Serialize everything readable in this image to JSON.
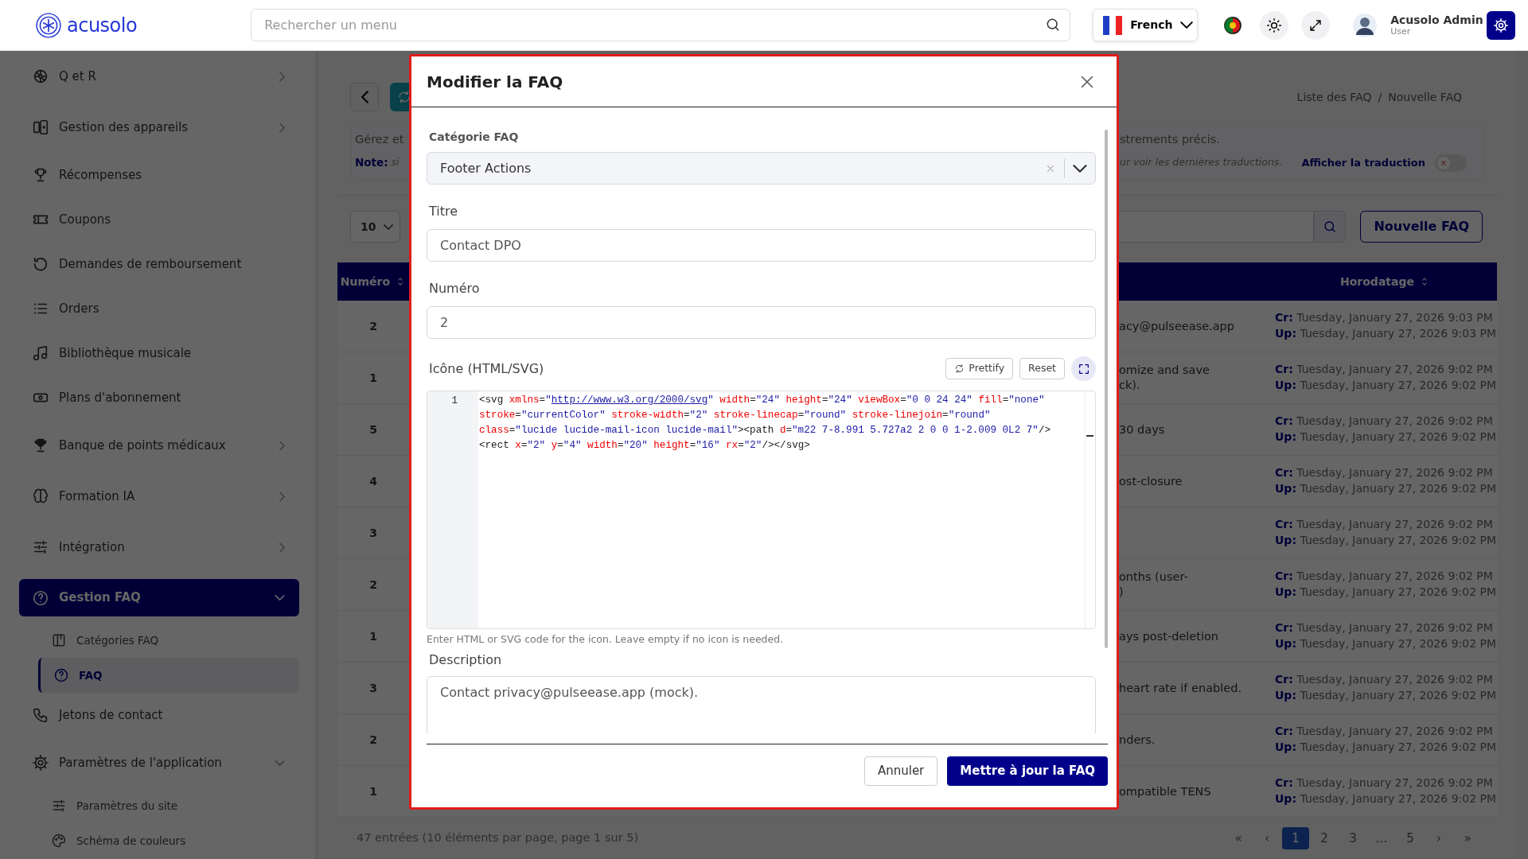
{
  "topbar": {
    "logo": "acusolo",
    "search": {
      "placeholder": "Rechercher un menu"
    },
    "language": "French",
    "user": {
      "name": "Acusolo Admin",
      "role": "User"
    }
  },
  "sidebar": {
    "items": [
      {
        "kind": "group",
        "label": "Q et R",
        "expanded": false,
        "selected": false
      },
      {
        "kind": "group",
        "label": "Gestion des appareils",
        "expanded": false,
        "selected": false
      },
      {
        "kind": "link",
        "label": "Récompenses",
        "selected": false
      },
      {
        "kind": "link",
        "label": "Coupons",
        "selected": false
      },
      {
        "kind": "link",
        "label": "Demandes de remboursement",
        "selected": false
      },
      {
        "kind": "link",
        "label": "Orders",
        "selected": false
      },
      {
        "kind": "link",
        "label": "Bibliothèque musicale",
        "selected": false
      },
      {
        "kind": "link",
        "label": "Plans d'abonnement",
        "selected": false
      },
      {
        "kind": "group",
        "label": "Banque de points médicaux",
        "expanded": false,
        "selected": false
      },
      {
        "kind": "group",
        "label": "Formation IA",
        "expanded": false,
        "selected": false
      },
      {
        "kind": "group",
        "label": "Intégration",
        "expanded": false,
        "selected": false
      },
      {
        "kind": "group",
        "label": "Gestion FAQ",
        "expanded": true,
        "selected": true,
        "children": [
          {
            "label": "Catégories FAQ",
            "selected": false
          },
          {
            "label": "FAQ",
            "selected": true
          }
        ]
      },
      {
        "kind": "link",
        "label": "Jetons de contact",
        "selected": false
      },
      {
        "kind": "group",
        "label": "Paramètres de l'application",
        "expanded": true,
        "selected": false,
        "children": [
          {
            "label": "Paramètres du site",
            "selected": false
          },
          {
            "label": "Schéma de couleurs",
            "selected": false
          }
        ]
      }
    ]
  },
  "page": {
    "breadcrumb": [
      "Liste des FAQ",
      "Nouvelle FAQ"
    ],
    "breadcrumb_separator": "/",
    "info": {
      "line_start": "Gérez et",
      "line_end": "strements précis.",
      "note_label": "Note:",
      "note_start": "si",
      "note_end": "ur voir les dernières traductions.",
      "toggle": {
        "label": "Afficher la traduction",
        "on": false
      }
    },
    "page_size": "10",
    "new_button": "Nouvelle FAQ",
    "table": {
      "columns": [
        "Numéro",
        "Horodatage"
      ],
      "rows": [
        {
          "number": "2",
          "description": [
            "acy@pulseease.app"
          ],
          "created_label": "Cr:",
          "created": "Tuesday, January 27, 2026 9:03 PM",
          "updated_label": "Up:",
          "updated": "Tuesday, January 27, 2026 9:03 PM"
        },
        {
          "number": "1",
          "description": [
            "omize and save",
            "ck)."
          ],
          "created_label": "Cr:",
          "created": "Tuesday, January 27, 2026 9:02 PM",
          "updated_label": "Up:",
          "updated": "Tuesday, January 27, 2026 9:02 PM"
        },
        {
          "number": "5",
          "description": [
            "30 days"
          ],
          "created_label": "Cr:",
          "created": "Tuesday, January 27, 2026 9:02 PM",
          "updated_label": "Up:",
          "updated": "Tuesday, January 27, 2026 9:02 PM"
        },
        {
          "number": "4",
          "description": [
            "ost-closure"
          ],
          "created_label": "Cr:",
          "created": "Tuesday, January 27, 2026 9:02 PM",
          "updated_label": "Up:",
          "updated": "Tuesday, January 27, 2026 9:02 PM"
        },
        {
          "number": "3",
          "created_label": "Cr:",
          "created": "Tuesday, January 27, 2026 9:02 PM",
          "updated_label": "Up:",
          "updated": "Tuesday, January 27, 2026 9:02 PM"
        },
        {
          "number": "2",
          "description": [
            "onths (user-",
            ")"
          ],
          "created_label": "Cr:",
          "created": "Tuesday, January 27, 2026 9:02 PM",
          "updated_label": "Up:",
          "updated": "Tuesday, January 27, 2026 9:02 PM"
        },
        {
          "number": "1",
          "description": [
            "ays post-deletion"
          ],
          "created_label": "Cr:",
          "created": "Tuesday, January 27, 2026 9:02 PM",
          "updated_label": "Up:",
          "updated": "Tuesday, January 27, 2026 9:02 PM"
        },
        {
          "number": "3",
          "description": [
            "heart rate if enabled."
          ],
          "created_label": "Cr:",
          "created": "Tuesday, January 27, 2026 9:02 PM",
          "updated_label": "Up:",
          "updated": "Tuesday, January 27, 2026 9:02 PM"
        },
        {
          "number": "2",
          "description": [
            "nders."
          ],
          "created_label": "Cr:",
          "created": "Tuesday, January 27, 2026 9:02 PM",
          "updated_label": "Up:",
          "updated": "Tuesday, January 27, 2026 9:02 PM"
        },
        {
          "number": "1",
          "description": [
            "ompatible TENS"
          ],
          "created_label": "Cr:",
          "created": "Tuesday, January 27, 2026 9:02 PM",
          "updated_label": "Up:",
          "updated": "Tuesday, January 27, 2026 9:02 PM"
        }
      ]
    },
    "summary": "47 entrées (10 éléments par page, page 1 sur 5)",
    "pagination": [
      {
        "label": "«",
        "selected": false
      },
      {
        "label": "‹",
        "selected": false
      },
      {
        "label": "1",
        "selected": true
      },
      {
        "label": "2",
        "selected": false
      },
      {
        "label": "3",
        "selected": false
      },
      {
        "label": "...",
        "selected": false
      },
      {
        "label": "5",
        "selected": false
      },
      {
        "label": "›",
        "selected": false
      },
      {
        "label": "»",
        "selected": false
      }
    ]
  },
  "modal": {
    "title": "Modifier la FAQ",
    "fields": [
      {
        "kind": "select",
        "label": "Catégorie FAQ",
        "value": "Footer Actions"
      },
      {
        "kind": "input",
        "label": "Titre",
        "value": "Contact DPO"
      },
      {
        "kind": "input",
        "label": "Numéro",
        "value": "2"
      },
      {
        "kind": "code",
        "label": "Icône (HTML/SVG)",
        "buttons": [
          "Prettify",
          "Reset"
        ],
        "line_numbers": [
          "1"
        ],
        "value": "<svg xmlns=\"http://www.w3.org/2000/svg\" width=\"24\" height=\"24\" viewBox=\"0 0 24 24\" fill=\"none\" stroke=\"currentColor\" stroke-width=\"2\" stroke-linecap=\"round\" stroke-linejoin=\"round\" class=\"lucide lucide-mail-icon lucide-mail\"><path d=\"m22 7-8.991 5.727a2 2 0 0 1-2.009 0L2 7\"/><rect x=\"2\" y=\"4\" width=\"20\" height=\"16\" rx=\"2\"/></svg>",
        "help": "Enter HTML or SVG code for the icon. Leave empty if no icon is needed."
      },
      {
        "kind": "textarea",
        "label": "Description",
        "value": "Contact privacy@pulseease.app (mock)."
      }
    ],
    "buttons": [
      {
        "kind": "secondary",
        "label": "Annuler"
      },
      {
        "kind": "primary",
        "label": "Mettre à jour la FAQ"
      }
    ]
  }
}
